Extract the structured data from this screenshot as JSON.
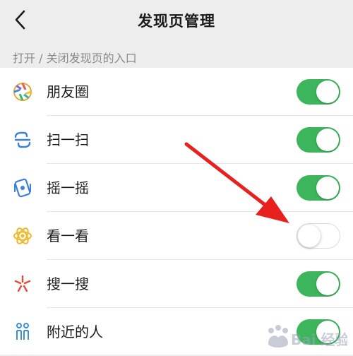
{
  "header": {
    "back_icon": "chevron-left-icon",
    "title": "发现页管理"
  },
  "section": {
    "label": "打开 / 关闭发现页的入口"
  },
  "items": [
    {
      "label": "朋友圈",
      "icon": "moments-aperture-icon",
      "enabled": true
    },
    {
      "label": "扫一扫",
      "icon": "scan-icon",
      "enabled": true
    },
    {
      "label": "摇一摇",
      "icon": "shake-icon",
      "enabled": true
    },
    {
      "label": "看一看",
      "icon": "top-stories-icon",
      "enabled": false
    },
    {
      "label": "搜一搜",
      "icon": "search-sparkle-icon",
      "enabled": true
    },
    {
      "label": "附近的人",
      "icon": "people-nearby-icon",
      "enabled": true
    }
  ],
  "colors": {
    "toggle_on": "#3cb55c",
    "annotation_arrow": "#e8201e",
    "background": "#ededed"
  },
  "annotation": {
    "arrow_icon": "red-arrow-pointing-to-toggle-icon"
  },
  "watermark": {
    "text": "Bai 经验"
  }
}
